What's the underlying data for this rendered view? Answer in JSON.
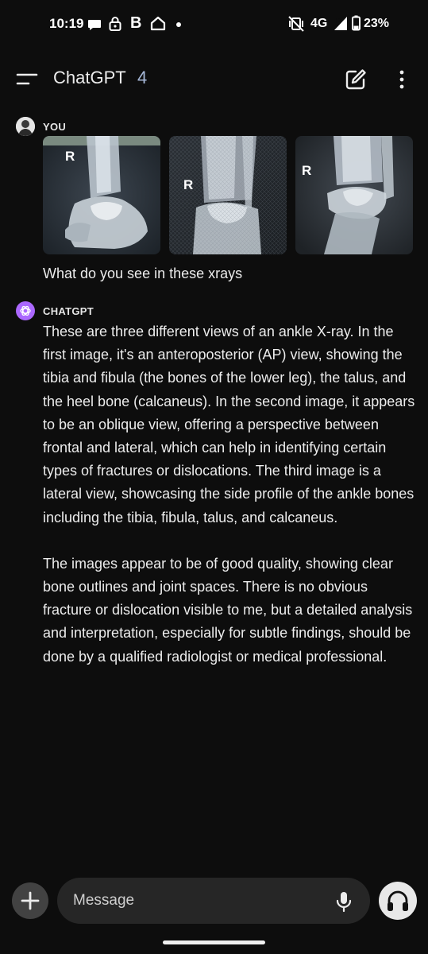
{
  "status_bar": {
    "time": "10:19",
    "b_icon_text": "B",
    "network": "4G",
    "battery": "23%",
    "icons": [
      "chat-bubble-icon",
      "lock-icon",
      "home-icon",
      "dot-icon",
      "vibrate-off-icon",
      "signal-icon",
      "battery-icon"
    ]
  },
  "app_bar": {
    "title": "ChatGPT",
    "version": "4",
    "icons": [
      "menu-icon",
      "new-chat-icon",
      "more-vert-icon"
    ]
  },
  "conversation": {
    "user": {
      "label": "YOU",
      "images": [
        {
          "marker": "R"
        },
        {
          "marker": "R"
        },
        {
          "marker": "R"
        }
      ],
      "text": "What do you see in these xrays"
    },
    "assistant": {
      "label": "CHATGPT",
      "paragraphs": [
        "These are three different views of an ankle X-ray. In the first image, it's an anteroposterior (AP) view, showing the tibia and fibula (the bones of the lower leg), the talus, and the heel bone (calcaneus). In the second image, it appears to be an oblique view, offering a perspective between frontal and lateral, which can help in identifying certain types of fractures or dislocations. The third image is a lateral view, showcasing the side profile of the ankle bones including the tibia, fibula, talus, and calcaneus.",
        "The images appear to be of good quality, showing clear bone outlines and joint spaces. There is no obvious fracture or dislocation visible to me, but a detailed analysis and interpretation, especially for subtle findings, should be done by a qualified radiologist or medical professional."
      ]
    }
  },
  "composer": {
    "placeholder": "Message",
    "icons": [
      "plus-icon",
      "mic-icon",
      "headphones-icon"
    ]
  },
  "colors": {
    "background": "#0d0d0d",
    "text": "#ececec",
    "version_accent": "#a6b8d8",
    "gpt_avatar": "#ab68ff",
    "input_background": "#262626"
  }
}
